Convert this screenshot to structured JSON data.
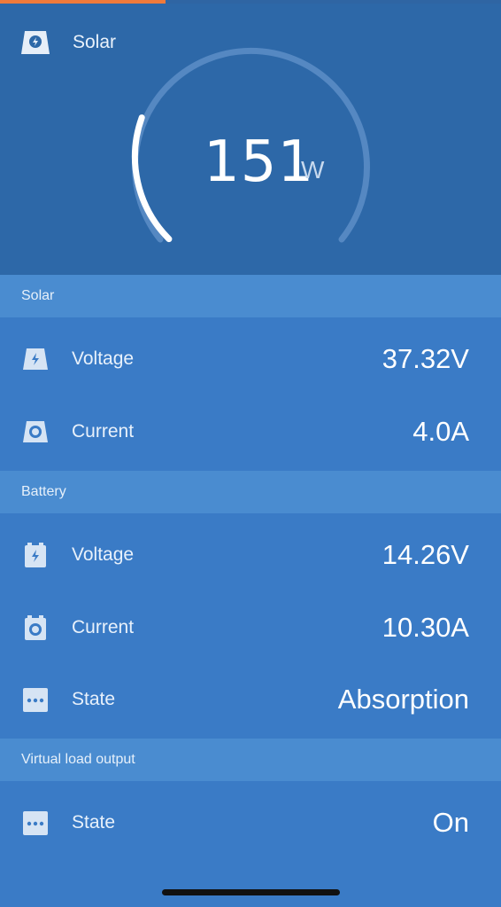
{
  "top_progress": {
    "fraction": 0.33,
    "color": "#f07a3a"
  },
  "header": {
    "title": "Solar",
    "icon": "solar-charger-icon"
  },
  "gauge": {
    "value": "151",
    "unit": "W",
    "fill_fraction": 0.24
  },
  "sections": {
    "solar": {
      "title": "Solar",
      "rows": [
        {
          "label": "Voltage",
          "value": "37.32V",
          "icon": "solar-voltage-icon"
        },
        {
          "label": "Current",
          "value": "4.0A",
          "icon": "solar-current-icon"
        }
      ]
    },
    "battery": {
      "title": "Battery",
      "rows": [
        {
          "label": "Voltage",
          "value": "14.26V",
          "icon": "battery-voltage-icon"
        },
        {
          "label": "Current",
          "value": "10.30A",
          "icon": "battery-current-icon"
        },
        {
          "label": "State",
          "value": "Absorption",
          "icon": "more-dots-icon"
        }
      ]
    },
    "virtual_load": {
      "title": "Virtual load output",
      "rows": [
        {
          "label": "State",
          "value": "On",
          "icon": "more-dots-icon"
        }
      ]
    }
  },
  "colors": {
    "hero_bg": "#2d68a8",
    "body_bg": "#3a7bc6",
    "section_header_bg": "#4a8cd0",
    "accent_orange": "#f07a3a"
  }
}
